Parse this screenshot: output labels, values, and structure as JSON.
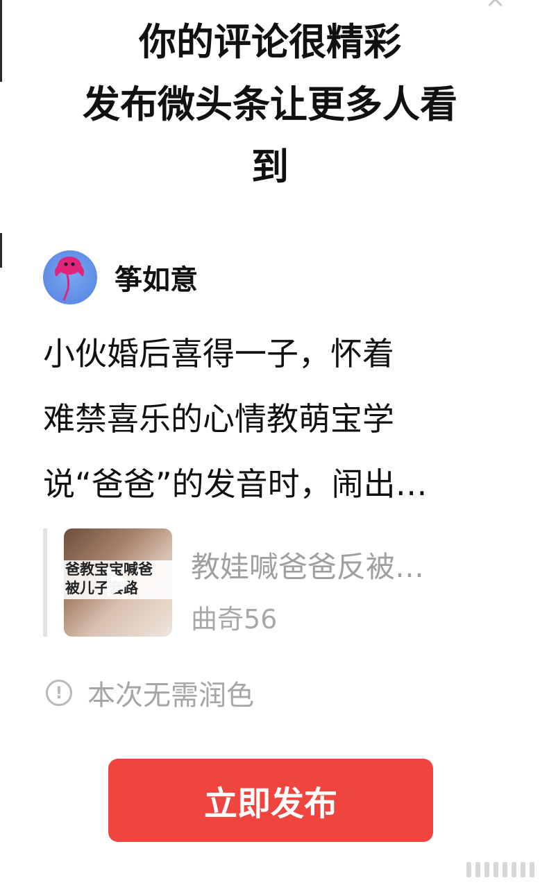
{
  "dialog": {
    "headline_lines": [
      "你的评论很精彩",
      "发布微头条让更多人看",
      "到"
    ],
    "close_icon": "close-icon"
  },
  "author": {
    "name": "筝如意",
    "avatar_icon": "kite-avatar-icon"
  },
  "post": {
    "lines": [
      "小伙婚后喜得一子，怀着",
      "难禁喜乐的心情教萌宝学",
      "说“爸爸”的发音时，闹出…"
    ]
  },
  "link_card": {
    "thumbnail_caption_lines": [
      "爸教宝宝喊爸",
      "被儿子套路"
    ],
    "title": "教娃喊爸爸反被…",
    "source": "曲奇56"
  },
  "note": {
    "text": "本次无需润色",
    "icon": "info-icon"
  },
  "actions": {
    "publish_label": "立即发布"
  },
  "colors": {
    "accent": "#f0443e",
    "muted_text": "#a6a6a6"
  }
}
